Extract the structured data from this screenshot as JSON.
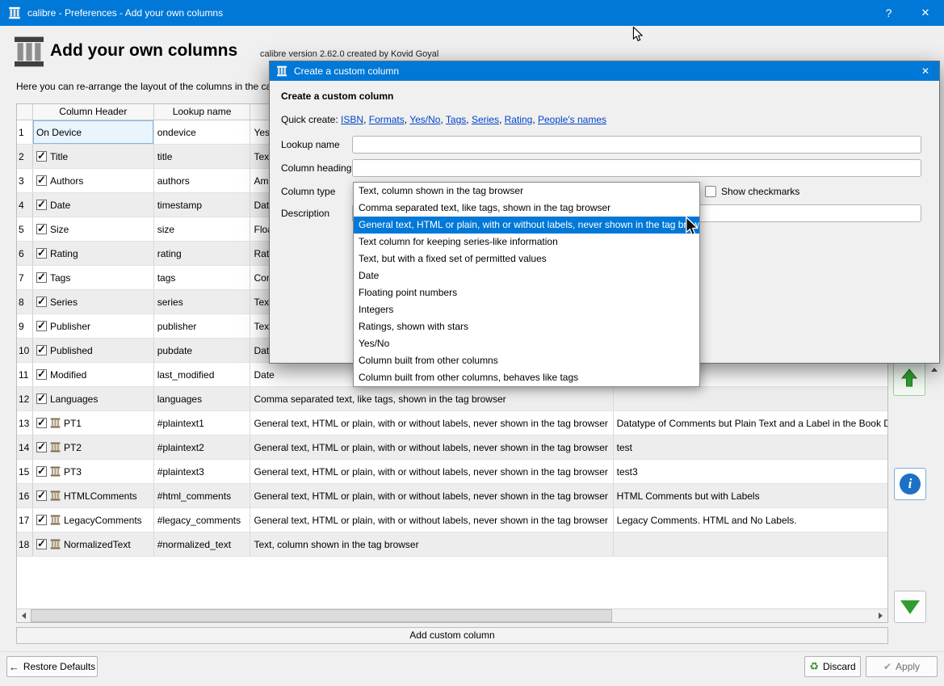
{
  "titlebar": {
    "title": "calibre - Preferences - Add your own columns",
    "help": "?",
    "close": "✕"
  },
  "header": {
    "title": "Add your own columns",
    "subtitle": "calibre version 2.62.0 created by Kovid Goyal"
  },
  "intro_text": "Here you can re-arrange the layout of the columns in the calibre l",
  "table": {
    "header_row": {
      "col1": "Column Header",
      "col2": "Lookup name"
    },
    "rows": [
      {
        "num": "1",
        "check": "none",
        "icon": false,
        "selected": true,
        "name": "On Device",
        "lookup": "ondevice",
        "datatype": "Yes/No",
        "description": ""
      },
      {
        "num": "2",
        "check": "checked",
        "icon": false,
        "selected": false,
        "name": "Title",
        "lookup": "title",
        "datatype": "Text",
        "description": ""
      },
      {
        "num": "3",
        "check": "checked",
        "icon": false,
        "selected": false,
        "name": "Authors",
        "lookup": "authors",
        "datatype": "Ampersand separated text, shown in the tag browser",
        "description": ""
      },
      {
        "num": "4",
        "check": "checked",
        "icon": false,
        "selected": false,
        "name": "Date",
        "lookup": "timestamp",
        "datatype": "Date",
        "description": ""
      },
      {
        "num": "5",
        "check": "checked",
        "icon": false,
        "selected": false,
        "name": "Size",
        "lookup": "size",
        "datatype": "Floating point numbers",
        "description": ""
      },
      {
        "num": "6",
        "check": "checked",
        "icon": false,
        "selected": false,
        "name": "Rating",
        "lookup": "rating",
        "datatype": "Ratings, shown with stars",
        "description": ""
      },
      {
        "num": "7",
        "check": "checked",
        "icon": false,
        "selected": false,
        "name": "Tags",
        "lookup": "tags",
        "datatype": "Comma separated text, like tags, shown in the tag browser",
        "description": ""
      },
      {
        "num": "8",
        "check": "checked",
        "icon": false,
        "selected": false,
        "name": "Series",
        "lookup": "series",
        "datatype": "Text column for keeping series-like information",
        "description": ""
      },
      {
        "num": "9",
        "check": "checked",
        "icon": false,
        "selected": false,
        "name": "Publisher",
        "lookup": "publisher",
        "datatype": "Text, column shown in the tag browser",
        "description": ""
      },
      {
        "num": "10",
        "check": "checked",
        "icon": false,
        "selected": false,
        "name": "Published",
        "lookup": "pubdate",
        "datatype": "Date",
        "description": ""
      },
      {
        "num": "11",
        "check": "checked",
        "icon": false,
        "selected": false,
        "name": "Modified",
        "lookup": "last_modified",
        "datatype": "Date",
        "description": ""
      },
      {
        "num": "12",
        "check": "checked",
        "icon": false,
        "selected": false,
        "name": "Languages",
        "lookup": "languages",
        "datatype": "Comma separated text, like tags, shown in the tag browser",
        "description": ""
      },
      {
        "num": "13",
        "check": "checked",
        "icon": true,
        "selected": false,
        "name": "PT1",
        "lookup": "#plaintext1",
        "datatype": "General text, HTML or plain, with or without labels, never shown in the tag browser",
        "description": "Datatype of Comments but Plain Text and a Label in the Book De"
      },
      {
        "num": "14",
        "check": "checked",
        "icon": true,
        "selected": false,
        "name": "PT2",
        "lookup": "#plaintext2",
        "datatype": "General text, HTML or plain, with or without labels, never shown in the tag browser",
        "description": "test"
      },
      {
        "num": "15",
        "check": "checked",
        "icon": true,
        "selected": false,
        "name": "PT3",
        "lookup": "#plaintext3",
        "datatype": "General text, HTML or plain, with or without labels, never shown in the tag browser",
        "description": "test3"
      },
      {
        "num": "16",
        "check": "checked",
        "icon": true,
        "selected": false,
        "name": "HTMLComments",
        "lookup": "#html_comments",
        "datatype": "General text, HTML or plain, with or without labels, never shown in the tag browser",
        "description": "HTML Comments but with Labels"
      },
      {
        "num": "17",
        "check": "checked",
        "icon": true,
        "selected": false,
        "name": "LegacyComments",
        "lookup": "#legacy_comments",
        "datatype": "General text, HTML or plain, with or without labels, never shown in the tag browser",
        "description": "Legacy Comments.  HTML and No Labels."
      },
      {
        "num": "18",
        "check": "checked",
        "icon": true,
        "selected": false,
        "name": "NormalizedText",
        "lookup": "#normalized_text",
        "datatype": "Text, column shown in the tag browser",
        "description": ""
      }
    ]
  },
  "add_button": "Add custom column",
  "footer": {
    "restore_defaults": "Restore Defaults",
    "discard": "Discard",
    "apply": "Apply"
  },
  "icons": {
    "restore_arrow": "←",
    "discard_recycle": "♻",
    "apply_check": "✔"
  },
  "dialog": {
    "title": "Create a custom column",
    "close": "✕",
    "heading": "Create a custom column",
    "quick_create_label": "Quick create:",
    "quick_links": [
      "ISBN",
      "Formats",
      "Yes/No",
      "Tags",
      "Series",
      "Rating",
      "People's names"
    ],
    "fields": {
      "lookup_name_label": "Lookup name",
      "column_heading_label": "Column heading",
      "column_type_label": "Column type",
      "description_label": "Description",
      "show_checkmarks_label": "Show checkmarks",
      "lookup_name_value": "",
      "column_heading_value": "",
      "description_value": ""
    },
    "dropdown": {
      "items": [
        "Text, column shown in the tag browser",
        "Comma separated text, like tags, shown in the tag browser",
        "General text, HTML or plain, with or without labels, never shown in the tag browser",
        "Text column for keeping series-like information",
        "Text, but with a fixed set of permitted values",
        "Date",
        "Floating point numbers",
        "Integers",
        "Ratings, shown with stars",
        "Yes/No",
        "Column built from other columns",
        "Column built from other columns, behaves like tags"
      ],
      "selected_index": 2
    }
  },
  "colors": {
    "titlebar_blue": "#0078d7",
    "selection_blue": "#0078d7",
    "link_blue": "#0044cc",
    "green_accent": "#2f9e2f"
  }
}
